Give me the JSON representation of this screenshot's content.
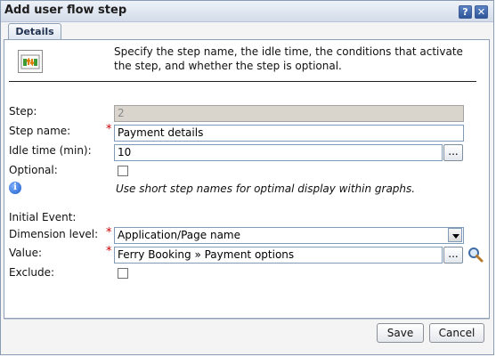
{
  "window": {
    "title": "Add user flow step",
    "help_glyph": "?",
    "close_glyph": "✕"
  },
  "tabs": [
    {
      "label": "Details"
    }
  ],
  "description": "Specify the step name, the idle time, the conditions that activate the step, and whether the step is optional.",
  "form": {
    "step": {
      "label": "Step:",
      "value": "2"
    },
    "step_name": {
      "label": "Step name:",
      "value": "Payment details",
      "required_mark": "*"
    },
    "idle_time": {
      "label": "Idle time (min):",
      "value": "10",
      "button": "..."
    },
    "optional": {
      "label": "Optional:",
      "checked": false
    },
    "info": "Use short step names for optimal display within graphs.",
    "initial_event": {
      "label": "Initial Event:"
    },
    "dimension_level": {
      "label": "Dimension level:",
      "value": "Application/Page name",
      "required_mark": "*"
    },
    "value": {
      "label": "Value:",
      "value": "Ferry Booking » Payment options",
      "required_mark": "*",
      "button": "..."
    },
    "exclude": {
      "label": "Exclude:",
      "checked": false
    }
  },
  "buttons": {
    "save": "Save",
    "cancel": "Cancel"
  },
  "colors": {
    "required": "#cc0000",
    "title_button": "#2e5598",
    "panel_border": "#8e9fb8"
  },
  "icons": [
    "user-flow-step-icon",
    "help-icon",
    "close-icon",
    "info-icon",
    "dropdown-arrow-icon",
    "magnifier-icon"
  ]
}
